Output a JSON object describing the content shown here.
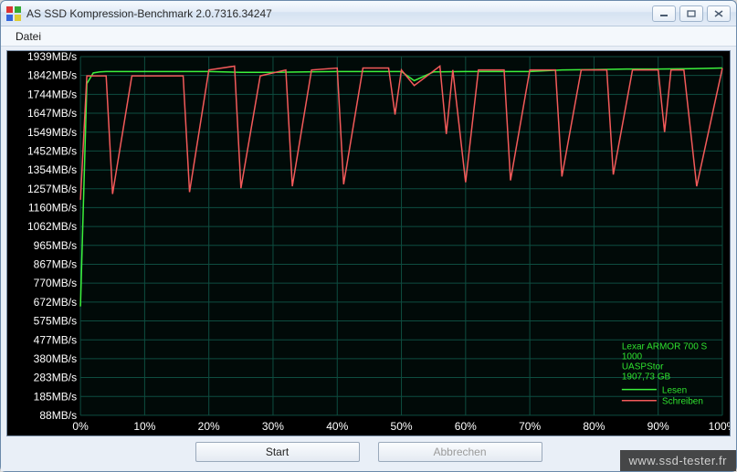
{
  "window": {
    "title": "AS SSD Kompression-Benchmark 2.0.7316.34247"
  },
  "menubar": {
    "items": [
      "Datei"
    ]
  },
  "buttons": {
    "start": "Start",
    "abort": "Abbrechen"
  },
  "watermark": "www.ssd-tester.fr",
  "legend": {
    "device": "Lexar ARMOR 700 S",
    "firmware": "1000",
    "driver": "UASPStor",
    "capacity": "1907,73 GB",
    "read_label": "Lesen",
    "write_label": "Schreiben"
  },
  "chart_data": {
    "type": "line",
    "xlabel": "",
    "ylabel": "",
    "x_unit": "%",
    "y_unit": "MB/s",
    "xlim": [
      0,
      100
    ],
    "ylim": [
      88,
      1939
    ],
    "y_ticks": [
      88,
      185,
      283,
      380,
      477,
      575,
      672,
      770,
      867,
      965,
      1062,
      1160,
      1257,
      1354,
      1452,
      1549,
      1647,
      1744,
      1842,
      1939
    ],
    "x_ticks": [
      0,
      10,
      20,
      30,
      40,
      50,
      60,
      70,
      80,
      90,
      100
    ],
    "series": [
      {
        "name": "Lesen",
        "color": "#3cf13c",
        "x": [
          0,
          1,
          2,
          3,
          4,
          5,
          7,
          10,
          15,
          20,
          25,
          30,
          35,
          40,
          45,
          50,
          52,
          55,
          60,
          65,
          70,
          75,
          80,
          85,
          90,
          95,
          100
        ],
        "y": [
          650,
          1800,
          1855,
          1860,
          1862,
          1862,
          1862,
          1862,
          1862,
          1862,
          1858,
          1858,
          1860,
          1862,
          1862,
          1862,
          1815,
          1860,
          1862,
          1862,
          1862,
          1870,
          1872,
          1875,
          1875,
          1877,
          1880
        ]
      },
      {
        "name": "Schreiben",
        "color": "#f35a5a",
        "x": [
          0,
          1,
          2,
          3,
          4,
          5,
          8,
          9,
          12,
          16,
          17,
          20,
          24,
          25,
          28,
          32,
          33,
          36,
          40,
          41,
          44,
          48,
          49,
          50,
          52,
          56,
          57,
          58,
          60,
          62,
          66,
          67,
          70,
          74,
          75,
          78,
          82,
          83,
          86,
          90,
          91,
          92,
          94,
          96,
          100
        ],
        "y": [
          1200,
          1840,
          1840,
          1840,
          1840,
          1230,
          1840,
          1840,
          1840,
          1840,
          1240,
          1870,
          1890,
          1260,
          1840,
          1870,
          1270,
          1870,
          1880,
          1280,
          1880,
          1880,
          1640,
          1870,
          1790,
          1890,
          1540,
          1870,
          1290,
          1870,
          1870,
          1300,
          1870,
          1870,
          1320,
          1870,
          1870,
          1330,
          1870,
          1870,
          1550,
          1870,
          1870,
          1270,
          1880
        ]
      }
    ]
  }
}
